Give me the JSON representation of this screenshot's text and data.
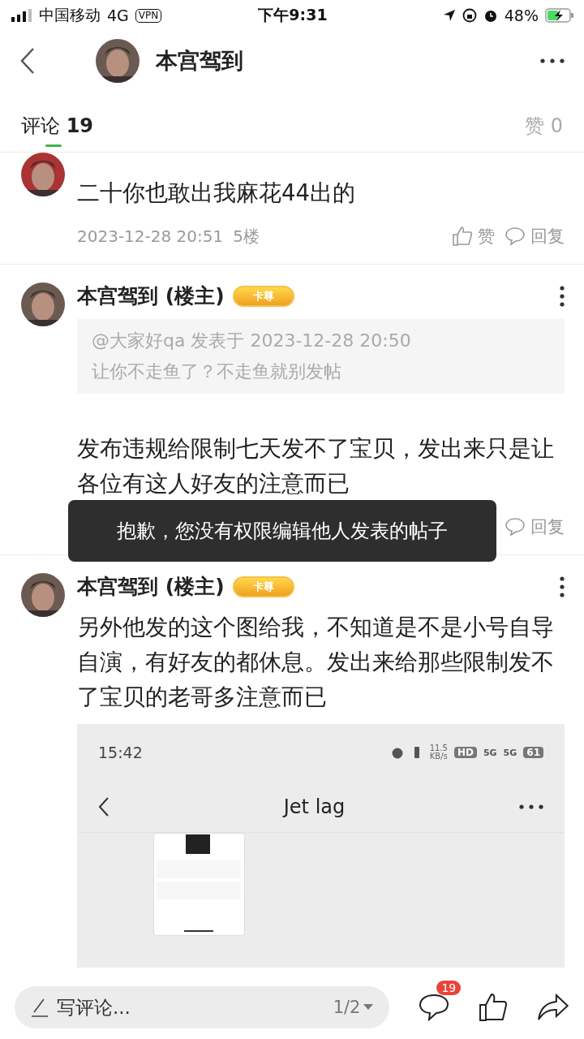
{
  "status_bar": {
    "carrier": "中国移动",
    "network": "4G",
    "vpn": "VPN",
    "time": "下午9:31",
    "battery": "48%",
    "charging": true
  },
  "header": {
    "title": "本宫驾到"
  },
  "tabs": [
    {
      "label": "评论",
      "count": "19",
      "selected": true
    },
    {
      "label": "赞",
      "count": "0",
      "selected": false
    }
  ],
  "comments": [
    {
      "body": "二十你也敢出我麻花44出的",
      "time": "2023-12-28 20:51",
      "floor": "5楼",
      "like": "赞",
      "reply": "回复"
    },
    {
      "author": "本宫驾到 (楼主)",
      "badge": "卡尊",
      "quote": {
        "source": "@大家好qa 发表于 2023-12-28 20:50",
        "text": "让你不走鱼了？不走鱼就别发帖"
      },
      "body": "发布违规给限制七天发不了宝贝，发出来只是让各位有这人好友的注意而已",
      "reply": "回复"
    },
    {
      "author": "本宫驾到 (楼主)",
      "badge": "卡尊",
      "body": "另外他发的这个图给我，不知道是不是小号自导自演，有好友的都休息。发出来给那些限制发不了宝贝的老哥多注意而已",
      "screenshot": {
        "time": "15:42",
        "speed": "11.5",
        "speed_unit": "KB/s",
        "hd": "HD",
        "net1": "5G",
        "net2": "5G",
        "battery": "61",
        "title": "Jet lag"
      }
    }
  ],
  "toast": "抱歉，您没有权限编辑他人发表的帖子",
  "bottom_bar": {
    "placeholder": "写评论...",
    "page": "1/2",
    "comment_count": "19"
  }
}
